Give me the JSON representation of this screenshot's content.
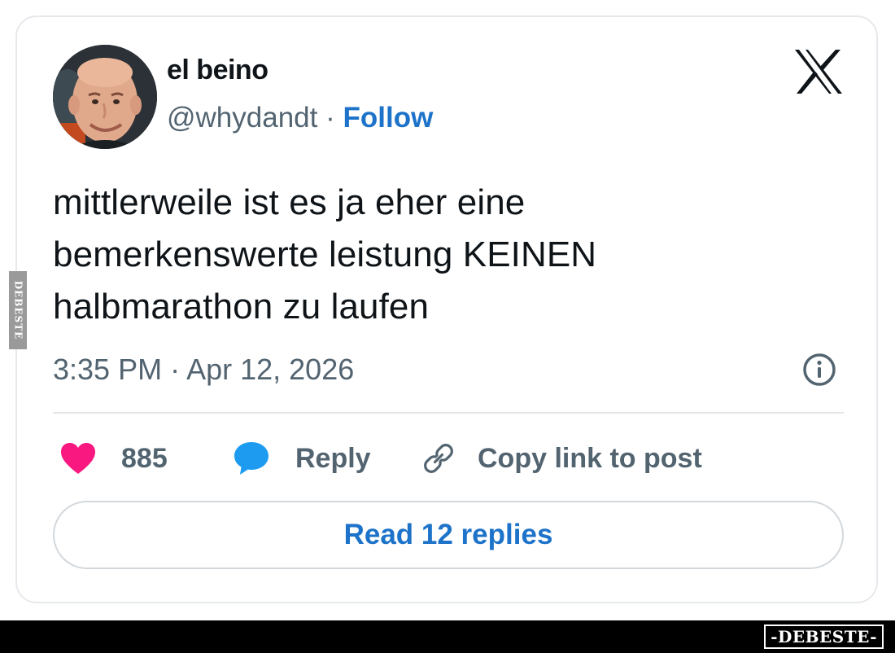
{
  "author": {
    "display_name": "el beino",
    "handle": "@whydandt",
    "separator": "·",
    "follow_label": "Follow"
  },
  "tweet": {
    "text_lines": [
      "mittlerweile ist es ja eher eine",
      "bemerkenswerte leistung KEINEN",
      "halbmarathon zu laufen"
    ],
    "timestamp": "3:35 PM · Apr 12, 2026"
  },
  "actions": {
    "like_count": "885",
    "reply_label": "Reply",
    "copy_link_label": "Copy link to post"
  },
  "read_replies_label": "Read 12 replies",
  "watermarks": {
    "side": "DEBESTE",
    "bottom": "-DEBESTE-"
  },
  "icons": {
    "brand": "x-logo-icon",
    "info": "info-icon",
    "like": "heart-icon",
    "reply": "speech-bubble-icon",
    "copy": "link-icon"
  },
  "colors": {
    "link_blue": "#1d73c9",
    "heart_pink": "#f91880",
    "reply_blue": "#1d9bf0",
    "secondary_text": "#536471"
  }
}
